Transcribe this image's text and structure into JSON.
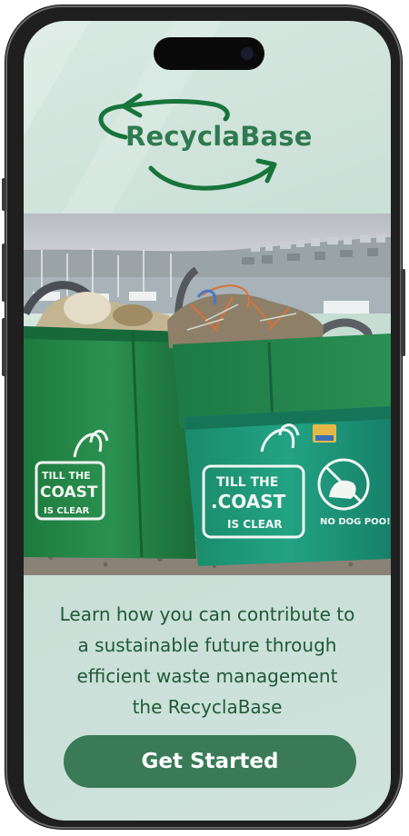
{
  "app": {
    "name": "RecyclaBase"
  },
  "hero": {
    "bag_left_text": "TILL THE COAST IS CLEAR",
    "bag_right_text_1": "TILL THE",
    "bag_right_text_2": ".COAST",
    "bag_right_text_3": "IS CLEAR",
    "bag_left_line_1": "TILL THE",
    "bag_left_line_2": "COAST",
    "bag_left_line_3": "IS CLEAR",
    "sign_text": "NO DOG POO!"
  },
  "content": {
    "tagline_line_1": "Learn how you can contribute to",
    "tagline_line_2": "a sustainable future through",
    "tagline_line_3": "efficient waste management",
    "tagline_line_4": "the RecyclaBase"
  },
  "actions": {
    "get_started_label": "Get Started"
  },
  "colors": {
    "brand_green": "#2f7a4f",
    "button_green": "#3a7a57",
    "background": "#d3e6de",
    "text_green": "#1f5a37"
  },
  "icons": {
    "logo": "recycle-arrows-icon"
  }
}
